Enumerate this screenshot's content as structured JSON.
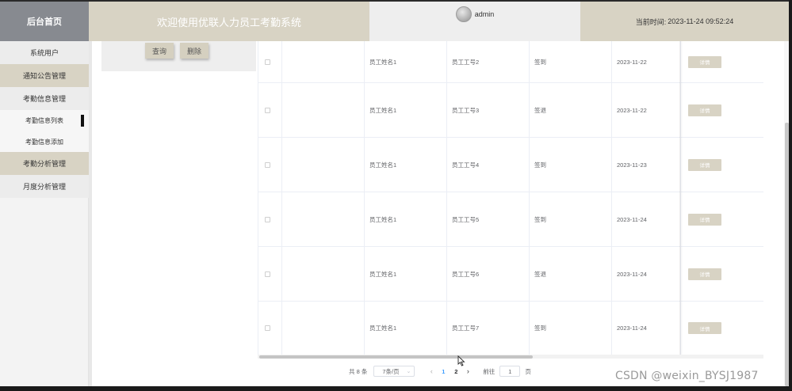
{
  "header": {
    "logo": "后台首页",
    "title": "欢迎使用优联人力员工考勤系统",
    "username": "admin",
    "time_label": "当前时间:",
    "time_value": "2023-11-24 09:52:24"
  },
  "sidebar": {
    "items": [
      {
        "label": "系统用户"
      },
      {
        "label": "通知公告管理"
      },
      {
        "label": "考勤信息管理"
      },
      {
        "label": "考勤信息列表"
      },
      {
        "label": "考勤信息添加"
      },
      {
        "label": "考勤分析管理"
      },
      {
        "label": "月度分析管理"
      }
    ]
  },
  "search": {
    "query_label": "查询",
    "delete_label": "删除"
  },
  "table": {
    "rows": [
      {
        "name": "员工姓名1",
        "id": "员工工号2",
        "type": "签到",
        "date": "2023-11-22",
        "action": "详情"
      },
      {
        "name": "员工姓名1",
        "id": "员工工号3",
        "type": "签退",
        "date": "2023-11-22",
        "action": "详情"
      },
      {
        "name": "员工姓名1",
        "id": "员工工号4",
        "type": "签到",
        "date": "2023-11-23",
        "action": "详情"
      },
      {
        "name": "员工姓名1",
        "id": "员工工号5",
        "type": "签到",
        "date": "2023-11-24",
        "action": "详情"
      },
      {
        "name": "员工姓名1",
        "id": "员工工号6",
        "type": "签退",
        "date": "2023-11-24",
        "action": "详情"
      },
      {
        "name": "员工姓名1",
        "id": "员工工号7",
        "type": "签到",
        "date": "2023-11-24",
        "action": "详情"
      }
    ]
  },
  "pagination": {
    "total": "共 8 条",
    "page_size": "7条/页",
    "pages": [
      "1",
      "2"
    ],
    "current_page": "1",
    "goto_label": "前往",
    "goto_value": "1",
    "page_unit": "页"
  },
  "watermark": "CSDN @weixin_BYSJ1987",
  "colors": {
    "accent": "#d8d3c4",
    "logo_bg": "#878a90",
    "page_active": "#409eff"
  }
}
